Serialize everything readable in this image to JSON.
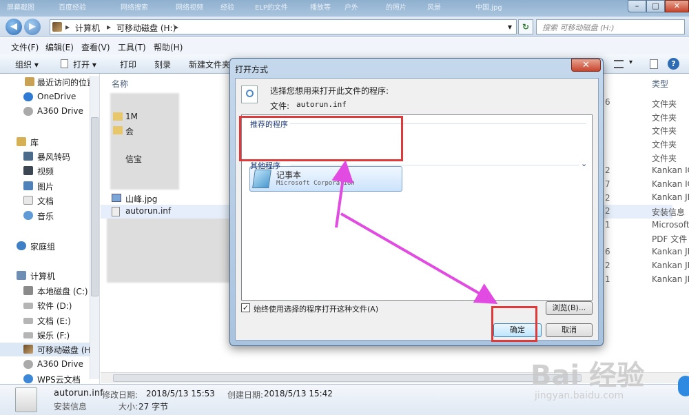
{
  "titlebar": {
    "faded_tabs": [
      "屏幕截图",
      "百度经验",
      "网络搜索",
      "网络视频",
      "经验",
      "ELP的文件",
      "播放等",
      "户外",
      "的照片",
      "风景",
      "中国.jpg"
    ],
    "minimize": "–",
    "maximize": "□",
    "close": "✕"
  },
  "address": {
    "back": "◀",
    "forward": "▶",
    "path": [
      "计算机",
      "可移动磁盘 (H:)"
    ],
    "sep": "▸",
    "dropdown": "▾",
    "refresh": "↻",
    "search_placeholder": "搜索 可移动磁盘 (H:)"
  },
  "menubar": [
    "文件(F)",
    "编辑(E)",
    "查看(V)",
    "工具(T)",
    "帮助(H)"
  ],
  "toolbar": {
    "organize": "组织 ▾",
    "open": "打开 ▾",
    "print": "打印",
    "burn": "刻录",
    "new_folder": "新建文件夹",
    "help": "?"
  },
  "sidebar": {
    "items": [
      {
        "label": "最近访问的位置",
        "icon": "recent-places-icon"
      },
      {
        "label": "OneDrive",
        "icon": "onedrive-icon"
      },
      {
        "label": "A360 Drive",
        "icon": "a360-drive-icon"
      },
      {
        "label": "库",
        "icon": "library-icon"
      },
      {
        "label": "暴风转码",
        "icon": "baofeng-icon"
      },
      {
        "label": "视频",
        "icon": "video-library-icon"
      },
      {
        "label": "图片",
        "icon": "picture-library-icon"
      },
      {
        "label": "文档",
        "icon": "document-library-icon"
      },
      {
        "label": "音乐",
        "icon": "music-library-icon"
      },
      {
        "label": "家庭组",
        "icon": "homegroup-icon"
      },
      {
        "label": "计算机",
        "icon": "computer-icon"
      },
      {
        "label": "本地磁盘 (C:)",
        "icon": "local-disk-icon"
      },
      {
        "label": "软件 (D:)",
        "icon": "drive-icon"
      },
      {
        "label": "文档 (E:)",
        "icon": "drive-icon"
      },
      {
        "label": "娱乐 (F:)",
        "icon": "drive-icon"
      },
      {
        "label": "可移动磁盘 (H",
        "icon": "removable-disk-icon"
      },
      {
        "label": "A360 Drive",
        "icon": "a360-drive-icon"
      },
      {
        "label": "WPS云文档",
        "icon": "wps-cloud-icon"
      }
    ]
  },
  "filelist": {
    "col_name": "名称",
    "col_type": "类型",
    "files": [
      {
        "name": "1M",
        "icon": "folder"
      },
      {
        "name": "会",
        "icon": "folder"
      },
      {
        "name": "",
        "icon": "folder"
      },
      {
        "name": "信宝",
        "icon": "file"
      },
      {
        "name": "",
        "icon": "file"
      },
      {
        "name": "山峰.jpg",
        "icon": "image"
      },
      {
        "name": "autorun.inf",
        "icon": "inf"
      }
    ],
    "types": [
      "文件夹",
      "文件夹",
      "文件夹",
      "文件夹",
      "文件夹",
      "Kankan IC",
      "Kankan IC",
      "Kankan JP",
      "安装信息",
      "Microsoft",
      "PDF 文件",
      "Kankan JP",
      "Kankan JP",
      "Kankan JP"
    ],
    "size_fragments": [
      "6",
      "2",
      "7",
      "2",
      "2",
      "1",
      "6",
      "2",
      "1"
    ]
  },
  "details": {
    "filename": "autorun.inf",
    "type": "安装信息",
    "modified_label": "修改日期:",
    "modified": "2018/5/13 15:53",
    "created_label": "创建日期:",
    "created": "2018/5/13 15:42",
    "size_label": "大小:",
    "size": "27 字节"
  },
  "dialog": {
    "title": "打开方式",
    "close": "✕",
    "prompt": "选择您想用来打开此文件的程序:",
    "file_label": "文件:",
    "file_name": "autorun.inf",
    "recommended_section": "推荐的程序",
    "other_section": "其他程序",
    "program_name": "记事本",
    "program_company": "Microsoft Corporation",
    "checkbox_label": "始终使用选择的程序打开这种文件(A)",
    "checkbox_checked": true,
    "browse": "浏览(B)...",
    "ok": "确定",
    "cancel": "取消"
  },
  "watermark": {
    "brand": "Bai 经验",
    "url": "jingyan.baidu.com"
  },
  "colors": {
    "annotation_red": "#e0393a",
    "annotation_arrow": "#e24be2",
    "dialog_frame": "#b6cde6"
  }
}
